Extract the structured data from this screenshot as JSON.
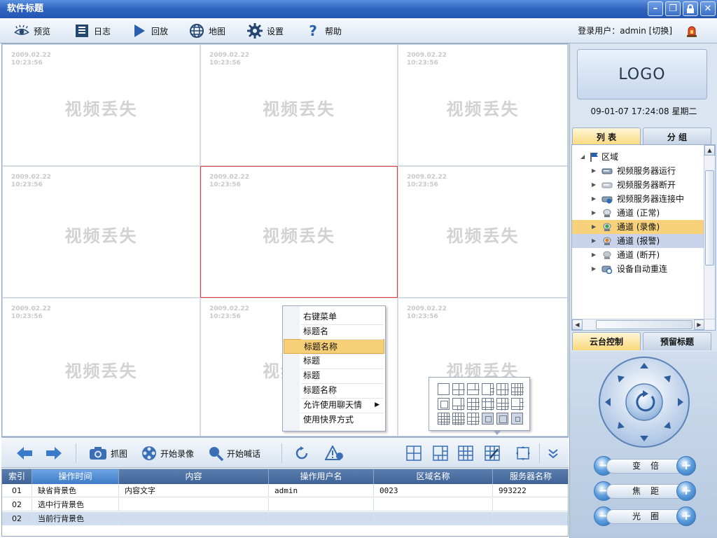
{
  "window": {
    "title": "软件标题",
    "buttons": [
      "–",
      "❐",
      "🔒",
      "✕"
    ]
  },
  "toolbar": {
    "items": [
      {
        "label": "预览",
        "icon": "eye-icon"
      },
      {
        "label": "日志",
        "icon": "log-icon"
      },
      {
        "label": "回放",
        "icon": "play-icon"
      },
      {
        "label": "地图",
        "icon": "globe-icon"
      },
      {
        "label": "设置",
        "icon": "gear-icon"
      },
      {
        "label": "帮助",
        "icon": "help-icon"
      }
    ],
    "login_text": "登录用户：admin [切换]"
  },
  "video": {
    "timestamp": "2009.02.22\n10:23:56",
    "lost_text": "视频丢失"
  },
  "context_menu": {
    "items": [
      "右键菜单",
      "标题名",
      "标题名称",
      "标题",
      "标题",
      "标题名称",
      "允许使用聊天情",
      "使用快界方式"
    ],
    "highlighted_index": 2,
    "submenu_index": 6
  },
  "bottom_bar": {
    "capture_label": "抓图",
    "record_label": "开始录像",
    "talk_label": "开始喊话"
  },
  "log_table": {
    "columns": [
      "索引",
      "操作时间",
      "内容",
      "操作用户名",
      "区域名称",
      "服务器名称"
    ],
    "active_column": 1,
    "rows": [
      [
        "01",
        "缺省背景色",
        "内容文字",
        "admin",
        "0023",
        "993222"
      ],
      [
        "02",
        "选中行背景色",
        "",
        "",
        "",
        ""
      ],
      [
        "02",
        "当前行背景色",
        "",
        "",
        "",
        ""
      ]
    ]
  },
  "right_panel": {
    "logo_text": "LOGO",
    "datetime": "09-01-07 17:24:08 星期二",
    "tabs": [
      "列 表",
      "分 组"
    ],
    "active_tab": 0,
    "tree": {
      "root": "区域",
      "items": [
        {
          "label": "视频服务器运行",
          "icon": "server-running-icon",
          "state": "normal"
        },
        {
          "label": "视频服务器断开",
          "icon": "server-disconnected-icon",
          "state": "normal"
        },
        {
          "label": "视频服务器连接中",
          "icon": "server-connecting-icon",
          "state": "normal"
        },
        {
          "label": "通道 (正常)",
          "icon": "camera-normal-icon",
          "state": "normal"
        },
        {
          "label": "通道 (录像)",
          "icon": "camera-recording-icon",
          "state": "selected"
        },
        {
          "label": "通道 (报警)",
          "icon": "camera-alarm-icon",
          "state": "current"
        },
        {
          "label": "通道 (断开)",
          "icon": "camera-disconnected-icon",
          "state": "normal"
        },
        {
          "label": "设备自动重连",
          "icon": "device-reconnect-icon",
          "state": "normal"
        }
      ]
    },
    "ptz_tabs": [
      "云台控制",
      "预留标题"
    ],
    "ptz_active_tab": 0,
    "ptz_controls": [
      {
        "label": "变倍",
        "minus": "−",
        "plus": "+"
      },
      {
        "label": "焦距",
        "minus": "−",
        "plus": "+"
      },
      {
        "label": "光圈",
        "minus": "−",
        "plus": "+"
      }
    ]
  },
  "colors": {
    "title_bar": "#2f63bf",
    "selected_cell_border": "#e53b3b",
    "highlight": "#f7cf76",
    "current_row": "#c9d3ec"
  }
}
